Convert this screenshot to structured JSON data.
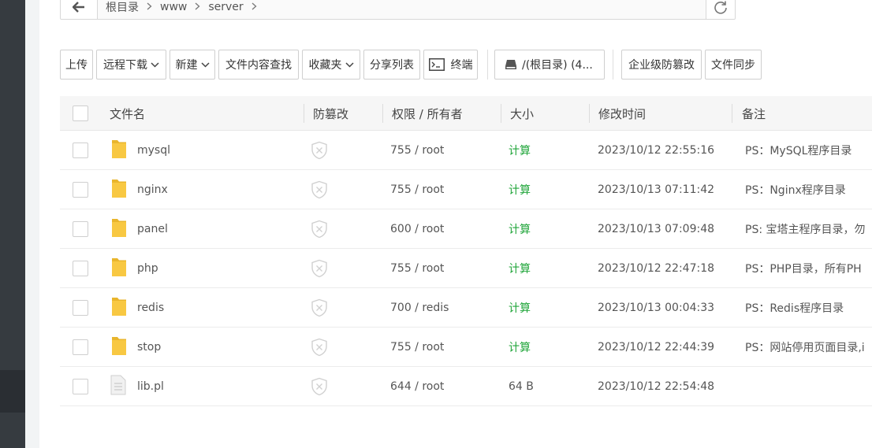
{
  "breadcrumbs": [
    {
      "label": "根目录"
    },
    {
      "label": "www"
    },
    {
      "label": "server"
    }
  ],
  "toolbar": {
    "upload": "上传",
    "remote_download": "远程下载",
    "new": "新建",
    "content_search": "文件内容查找",
    "favorites": "收藏夹",
    "share_list": "分享列表",
    "terminal": "终端",
    "disk": "/(根目录) (4...",
    "tamper": "企业级防篡改",
    "sync": "文件同步"
  },
  "columns": {
    "name": "文件名",
    "tamper": "防篡改",
    "perm": "权限 / 所有者",
    "size": "大小",
    "mtime": "修改时间",
    "note": "备注"
  },
  "rows": [
    {
      "name": "mysql",
      "type": "folder",
      "perm": "755 / root",
      "size": "计算",
      "mtime": "2023/10/12 22:55:16",
      "note": "PS：MySQL程序目录"
    },
    {
      "name": "nginx",
      "type": "folder",
      "perm": "755 / root",
      "size": "计算",
      "mtime": "2023/10/13 07:11:42",
      "note": "PS：Nginx程序目录"
    },
    {
      "name": "panel",
      "type": "folder",
      "perm": "600 / root",
      "size": "计算",
      "mtime": "2023/10/13 07:09:48",
      "note": "PS: 宝塔主程序目录，勿"
    },
    {
      "name": "php",
      "type": "folder",
      "perm": "755 / root",
      "size": "计算",
      "mtime": "2023/10/12 22:47:18",
      "note": "PS：PHP目录，所有PH"
    },
    {
      "name": "redis",
      "type": "folder",
      "perm": "700 / redis",
      "size": "计算",
      "mtime": "2023/10/13 00:04:33",
      "note": "PS：Redis程序目录"
    },
    {
      "name": "stop",
      "type": "folder",
      "perm": "755 / root",
      "size": "计算",
      "mtime": "2023/10/12 22:44:39",
      "note": "PS：网站停用页面目录,i"
    },
    {
      "name": "lib.pl",
      "type": "file",
      "perm": "644 / root",
      "size": "64 B",
      "mtime": "2023/10/12 22:54:48",
      "note": ""
    }
  ],
  "colors": {
    "sidebar": "#363b40",
    "accent_green": "#20a53a",
    "folder": "#f8c842"
  }
}
